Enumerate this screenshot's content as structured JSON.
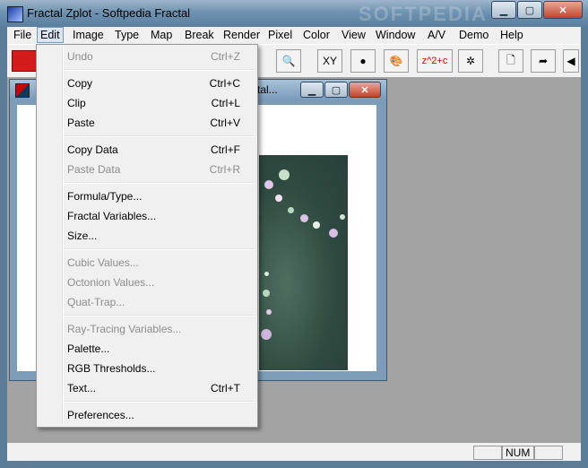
{
  "window": {
    "title": "Fractal Zplot - Softpedia Fractal",
    "watermark": "SOFTPEDIA",
    "minimize_glyph": "▁",
    "maximize_glyph": "▢",
    "close_glyph": "✕"
  },
  "menubar": {
    "items": [
      "File",
      "Edit",
      "Image",
      "Type",
      "Map",
      "Break",
      "Render",
      "Pixel",
      "Color",
      "View",
      "Window",
      "A/V",
      "Demo",
      "Help"
    ],
    "active": "Edit"
  },
  "toolbar": {
    "buttons": [
      {
        "icon": "zoom-icon",
        "glyph": "🔍"
      },
      {
        "icon": "xy-axis-icon",
        "glyph": "XY"
      },
      {
        "icon": "globe-icon",
        "glyph": "●"
      },
      {
        "icon": "palette-icon",
        "glyph": "🎨"
      },
      {
        "icon": "formula-icon",
        "glyph": "z^2+c"
      },
      {
        "icon": "pixel-icon",
        "glyph": "✲"
      },
      {
        "icon": "new-page-icon",
        "glyph": "🗋"
      },
      {
        "icon": "export-icon",
        "glyph": "➦"
      },
      {
        "icon": "nav-left-icon",
        "glyph": "◀"
      }
    ]
  },
  "child_window": {
    "title": "ctal...",
    "minimize_glyph": "▁",
    "maximize_glyph": "▢",
    "close_glyph": "✕"
  },
  "edit_menu": {
    "items": [
      {
        "label": "Undo",
        "shortcut": "Ctrl+Z",
        "enabled": false
      },
      {
        "label": "Copy",
        "shortcut": "Ctrl+C",
        "enabled": true
      },
      {
        "label": "Clip",
        "shortcut": "Ctrl+L",
        "enabled": true
      },
      {
        "label": "Paste",
        "shortcut": "Ctrl+V",
        "enabled": true
      },
      {
        "label": "Copy Data",
        "shortcut": "Ctrl+F",
        "enabled": true
      },
      {
        "label": "Paste Data",
        "shortcut": "Ctrl+R",
        "enabled": false
      },
      {
        "label": "Formula/Type...",
        "shortcut": "",
        "enabled": true
      },
      {
        "label": "Fractal Variables...",
        "shortcut": "",
        "enabled": true
      },
      {
        "label": "Size...",
        "shortcut": "",
        "enabled": true
      },
      {
        "label": "Cubic Values...",
        "shortcut": "",
        "enabled": false
      },
      {
        "label": "Octonion Values...",
        "shortcut": "",
        "enabled": false
      },
      {
        "label": "Quat-Trap...",
        "shortcut": "",
        "enabled": false
      },
      {
        "label": "Ray-Tracing Variables...",
        "shortcut": "",
        "enabled": false
      },
      {
        "label": "Palette...",
        "shortcut": "",
        "enabled": true
      },
      {
        "label": "RGB Thresholds...",
        "shortcut": "",
        "enabled": true
      },
      {
        "label": "Text...",
        "shortcut": "Ctrl+T",
        "enabled": true
      },
      {
        "label": "Preferences...",
        "shortcut": "",
        "enabled": true
      }
    ]
  },
  "statusbar": {
    "num": "NUM"
  },
  "colors": {
    "fractal_bg": "#2f4a40",
    "menu_bg": "#f0f0f0",
    "disabled_text": "#8d8d8d"
  }
}
